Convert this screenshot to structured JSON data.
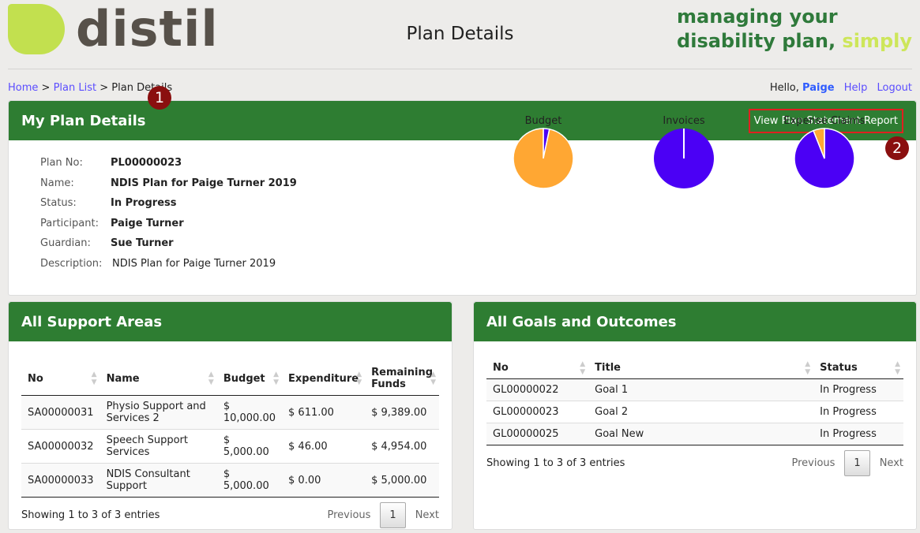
{
  "header": {
    "logo_text": "distil",
    "title": "Plan Details",
    "tagline_line1": "managing your",
    "tagline_line2": "disability plan, ",
    "tagline_highlight": "simply"
  },
  "breadcrumb": {
    "home": "Home",
    "plan_list": "Plan List",
    "current": "Plan Details",
    "sep": ">"
  },
  "user": {
    "greeting": "Hello, ",
    "name": "Paige",
    "help": "Help",
    "logout": "Logout"
  },
  "badges": [
    "1",
    "2"
  ],
  "plan": {
    "title": "My Plan Details",
    "report_button": "View Plan Statement Report",
    "fields": [
      {
        "label": "Plan No:",
        "value": "PL00000023"
      },
      {
        "label": "Name:",
        "value": "NDIS Plan for Paige Turner 2019"
      },
      {
        "label": "Status:",
        "value": "In Progress"
      },
      {
        "label": "Participant:",
        "value": "Paige Turner"
      },
      {
        "label": "Guardian:",
        "value": "Sue Turner"
      },
      {
        "label": "Description:",
        "value": "NDIS Plan for Paige Turner 2019"
      }
    ]
  },
  "colors": {
    "green": "#2e7d32",
    "orange": "#ffa733",
    "blue": "#4b00f5"
  },
  "chart_data": [
    {
      "type": "pie",
      "title": "Budget",
      "slices": [
        {
          "color": "#4b00f5",
          "value": 3.3
        },
        {
          "color": "#ffa733",
          "value": 96.7
        }
      ]
    },
    {
      "type": "pie",
      "title": "Invoices",
      "slices": [
        {
          "color": "#4b00f5",
          "value": 100
        }
      ]
    },
    {
      "type": "pie",
      "title": "Expense Claims",
      "slices": [
        {
          "color": "#4b00f5",
          "value": 94
        },
        {
          "color": "#ffa733",
          "value": 6
        }
      ]
    }
  ],
  "support": {
    "title": "All Support Areas",
    "columns": [
      "No",
      "Name",
      "Budget",
      "Expenditure",
      "Remaining Funds"
    ],
    "rows": [
      [
        "SA00000031",
        "Physio Support and Services 2",
        "$ 10,000.00",
        "$ 611.00",
        "$ 9,389.00"
      ],
      [
        "SA00000032",
        "Speech Support Services",
        "$ 5,000.00",
        "$ 46.00",
        "$ 4,954.00"
      ],
      [
        "SA00000033",
        "NDIS Consultant Support",
        "$ 5,000.00",
        "$ 0.00",
        "$ 5,000.00"
      ]
    ],
    "info": "Showing 1 to 3 of 3 entries",
    "prev": "Previous",
    "page": "1",
    "next": "Next"
  },
  "goals": {
    "title": "All Goals and Outcomes",
    "columns": [
      "No",
      "Title",
      "Status"
    ],
    "rows": [
      [
        "GL00000022",
        "Goal 1",
        "In Progress"
      ],
      [
        "GL00000023",
        "Goal 2",
        "In Progress"
      ],
      [
        "GL00000025",
        "Goal New",
        "In Progress"
      ]
    ],
    "info": "Showing 1 to 3 of 3 entries",
    "prev": "Previous",
    "page": "1",
    "next": "Next"
  }
}
